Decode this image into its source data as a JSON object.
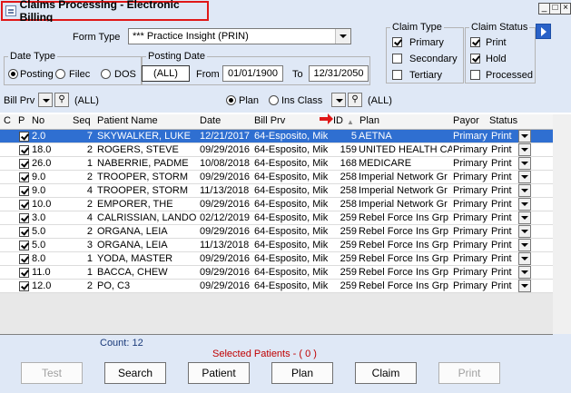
{
  "window": {
    "title": "Claims Processing - Electronic Billing"
  },
  "form_type": {
    "label": "Form Type",
    "value": "*** Practice Insight (PRIN)"
  },
  "claim_type": {
    "label": "Claim Type",
    "options": [
      {
        "label": "Primary",
        "checked": true
      },
      {
        "label": "Secondary",
        "checked": false
      },
      {
        "label": "Tertiary",
        "checked": false
      }
    ]
  },
  "claim_status": {
    "label": "Claim Status",
    "options": [
      {
        "label": "Print",
        "checked": true
      },
      {
        "label": "Hold",
        "checked": true
      },
      {
        "label": "Processed",
        "checked": false
      }
    ]
  },
  "date_type": {
    "label": "Date Type",
    "options": [
      {
        "label": "Posting",
        "selected": true
      },
      {
        "label": "Filec",
        "selected": false
      },
      {
        "label": "DOS",
        "selected": false
      }
    ]
  },
  "posting_date": {
    "label": "Posting Date",
    "all": "(ALL)",
    "from_label": "From",
    "from": "01/01/1900",
    "to_label": "To",
    "to": "12/31/2050"
  },
  "filter_bar": {
    "bill_prv_label": "Bill Prv",
    "bill_prv_value": "(ALL)",
    "plan_label": "Plan",
    "plan_selected": true,
    "ins_class_label": "Ins Class",
    "ins_value": "(ALL)"
  },
  "grid": {
    "columns": [
      "C",
      "P",
      "No",
      "Seq",
      "Patient Name",
      "Date",
      "Bill Prv",
      "ID",
      "Plan",
      "Payor",
      "Status"
    ],
    "rows": [
      {
        "p": true,
        "no": "2.0",
        "seq": "7",
        "name": "SKYWALKER, LUKE",
        "date": "12/21/2017",
        "bill": "64-Esposito, Mik",
        "id": "5",
        "plan": "AETNA",
        "payor": "Primary",
        "status": "Print",
        "selected": true
      },
      {
        "p": true,
        "no": "18.0",
        "seq": "2",
        "name": "ROGERS, STEVE",
        "date": "09/29/2016",
        "bill": "64-Esposito, Mik",
        "id": "159",
        "plan": "UNITED HEALTH CAR",
        "payor": "Primary",
        "status": "Print"
      },
      {
        "p": true,
        "no": "26.0",
        "seq": "1",
        "name": "NABERRIE, PADME",
        "date": "10/08/2018",
        "bill": "64-Esposito, Mik",
        "id": "168",
        "plan": "MEDICARE",
        "payor": "Primary",
        "status": "Print"
      },
      {
        "p": true,
        "no": "9.0",
        "seq": "2",
        "name": "TROOPER, STORM",
        "date": "09/29/2016",
        "bill": "64-Esposito, Mik",
        "id": "258",
        "plan": "Imperial Network Gr",
        "payor": "Primary",
        "status": "Print"
      },
      {
        "p": true,
        "no": "9.0",
        "seq": "4",
        "name": "TROOPER, STORM",
        "date": "11/13/2018",
        "bill": "64-Esposito, Mik",
        "id": "258",
        "plan": "Imperial Network Gr",
        "payor": "Primary",
        "status": "Print"
      },
      {
        "p": true,
        "no": "10.0",
        "seq": "2",
        "name": "EMPORER, THE",
        "date": "09/29/2016",
        "bill": "64-Esposito, Mik",
        "id": "258",
        "plan": "Imperial Network Gr",
        "payor": "Primary",
        "status": "Print"
      },
      {
        "p": true,
        "no": "3.0",
        "seq": "4",
        "name": "CALRISSIAN, LANDO",
        "date": "02/12/2019",
        "bill": "64-Esposito, Mik",
        "id": "259",
        "plan": "Rebel Force Ins Grp",
        "payor": "Primary",
        "status": "Print"
      },
      {
        "p": true,
        "no": "5.0",
        "seq": "2",
        "name": "ORGANA, LEIA",
        "date": "09/29/2016",
        "bill": "64-Esposito, Mik",
        "id": "259",
        "plan": "Rebel Force Ins Grp",
        "payor": "Primary",
        "status": "Print"
      },
      {
        "p": true,
        "no": "5.0",
        "seq": "3",
        "name": "ORGANA, LEIA",
        "date": "11/13/2018",
        "bill": "64-Esposito, Mik",
        "id": "259",
        "plan": "Rebel Force Ins Grp",
        "payor": "Primary",
        "status": "Print"
      },
      {
        "p": true,
        "no": "8.0",
        "seq": "1",
        "name": "YODA, MASTER",
        "date": "09/29/2016",
        "bill": "64-Esposito, Mik",
        "id": "259",
        "plan": "Rebel Force Ins Grp",
        "payor": "Primary",
        "status": "Print"
      },
      {
        "p": true,
        "no": "11.0",
        "seq": "1",
        "name": "BACCA, CHEW",
        "date": "09/29/2016",
        "bill": "64-Esposito, Mik",
        "id": "259",
        "plan": "Rebel Force Ins Grp",
        "payor": "Primary",
        "status": "Print"
      },
      {
        "p": true,
        "no": "12.0",
        "seq": "2",
        "name": "PO, C3",
        "date": "09/29/2016",
        "bill": "64-Esposito, Mik",
        "id": "259",
        "plan": "Rebel Force Ins Grp",
        "payor": "Primary",
        "status": "Print"
      }
    ]
  },
  "footer": {
    "count": "Count: 12",
    "selected": "Selected Patients  -  ( 0 )",
    "buttons": [
      {
        "label": "Test",
        "enabled": false
      },
      {
        "label": "Search",
        "enabled": true
      },
      {
        "label": "Patient",
        "enabled": true
      },
      {
        "label": "Plan",
        "enabled": true
      },
      {
        "label": "Claim",
        "enabled": true
      },
      {
        "label": "Print",
        "enabled": false
      }
    ]
  },
  "colors": {
    "panel": "#dfe8f6",
    "selection": "#2f6fd1",
    "highlight_border": "#e01818",
    "selected_text": "#c00000"
  }
}
